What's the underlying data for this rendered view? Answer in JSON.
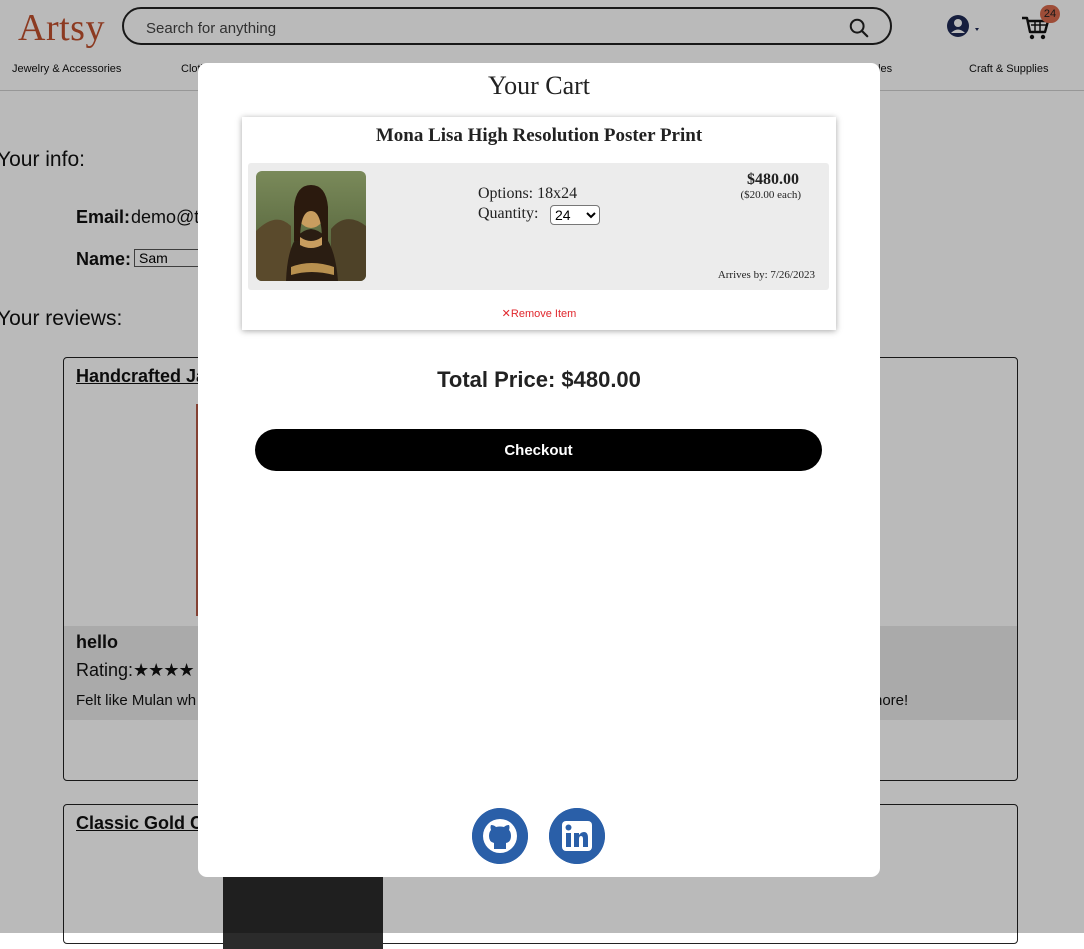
{
  "header": {
    "logo": "Artsy",
    "search_placeholder": "Search for anything",
    "cart_count": "24",
    "categories": [
      "Jewelry & Accessories",
      "Cloth",
      "bles",
      "Craft & Supplies"
    ]
  },
  "profile": {
    "info_heading": "Your info:",
    "email_label": "Email:",
    "email_value": "demo@te",
    "name_label": "Name:",
    "name_value": "Sam",
    "reviews_heading": "Your reviews:"
  },
  "reviews": [
    {
      "title": "Handcrafted Ja",
      "head": "hello",
      "rating_label": "Rating:",
      "rating_value": 4,
      "body_start": "Felt like Mulan wh",
      "body_end": "nore!"
    },
    {
      "title": "Classic Gold C"
    }
  ],
  "cart_modal": {
    "title": "Your Cart",
    "item": {
      "name": "Mona Lisa High Resolution Poster Print",
      "options_label": "Options: 18x24",
      "quantity_label": "Quantity:",
      "quantity_value": "24",
      "price": "$480.00",
      "each_price": "($20.00 each)",
      "arrives": "Arrives by: 7/26/2023",
      "remove_label": "Remove Item",
      "remove_icon": "close-x"
    },
    "total_label": "Total Price: $480.00",
    "checkout_label": "Checkout",
    "social_icons": [
      "github-icon",
      "linkedin-icon"
    ]
  },
  "colors": {
    "brand": "#c0502e",
    "badge": "#d96a4e",
    "remove": "#e0262c",
    "social": "#2a5fa8"
  }
}
